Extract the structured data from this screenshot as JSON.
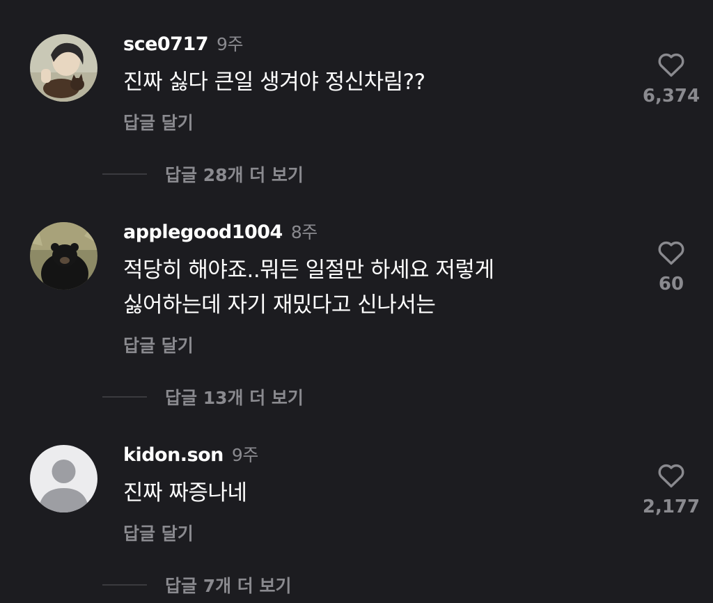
{
  "comments": [
    {
      "username": "sce0717",
      "age": "9주",
      "lines": [
        "진짜 싫다  큰일 생겨야 정신차림??"
      ],
      "reply_label": "답글 달기",
      "likes": "6,374",
      "more_replies": "답글 28개 더 보기",
      "avatar": "illustrated-person-with-cat-avatar"
    },
    {
      "username": "applegood1004",
      "age": "8주",
      "lines": [
        "적당히 해야죠..뭐든 일절만 하세요 저렇게",
        "싫어하는데 자기 재밌다고 신나서는"
      ],
      "reply_label": "답글 달기",
      "likes": "60",
      "more_replies": "답글 13개 더 보기",
      "avatar": "black-bear-photo-avatar"
    },
    {
      "username": "kidon.son",
      "age": "9주",
      "lines": [
        "진짜 짜증나네"
      ],
      "reply_label": "답글 달기",
      "likes": "2,177",
      "more_replies": "답글 7개 더 보기",
      "avatar": "default-person-avatar"
    }
  ],
  "colors": {
    "background": "#1c1c20",
    "primary_text": "#ffffff",
    "secondary_text": "#8a8a8f"
  },
  "icons": {
    "like": "heart-outline-icon"
  }
}
